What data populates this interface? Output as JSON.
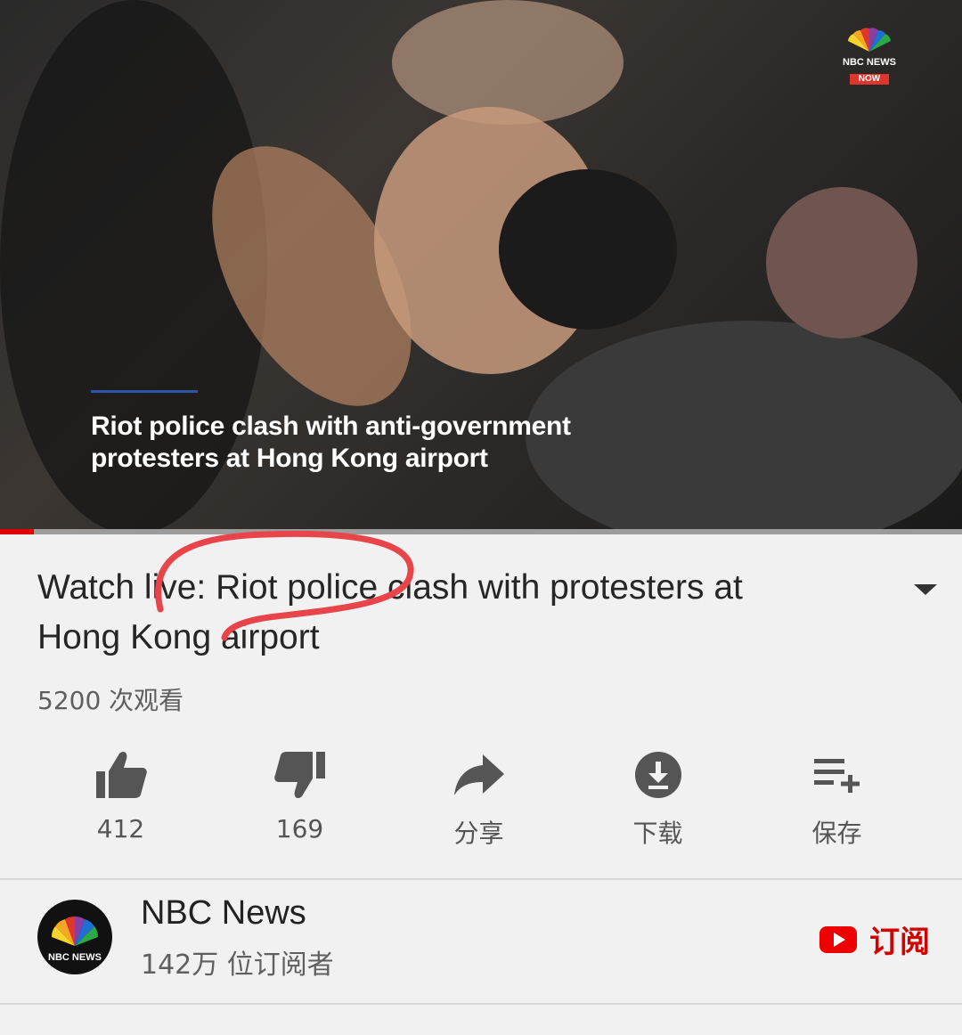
{
  "video": {
    "caption_line1": "Riot police clash with anti-government",
    "caption_line2": "protesters at Hong Kong airport",
    "badge_brand": "NBC NEWS",
    "badge_now": "NOW",
    "progress": 0.035,
    "progress_color": "#e00000"
  },
  "title": {
    "line1": "Watch live: Riot police clash with protesters at",
    "line2": "Hong Kong airport",
    "annotation_color": "#e8454b"
  },
  "views": "5200 次观看",
  "actions": {
    "like": {
      "icon": "thumbs-up-icon",
      "label": "412"
    },
    "dislike": {
      "icon": "thumbs-down-icon",
      "label": "169"
    },
    "share": {
      "icon": "share-icon",
      "label": "分享"
    },
    "download": {
      "icon": "download-icon",
      "label": "下载"
    },
    "save": {
      "icon": "playlist-add-icon",
      "label": "保存"
    }
  },
  "channel": {
    "name": "NBC News",
    "subscribers": "142万 位订阅者",
    "avatar_text": "NBC NEWS",
    "subscribe_label": "订阅",
    "accent": "#d30000"
  }
}
